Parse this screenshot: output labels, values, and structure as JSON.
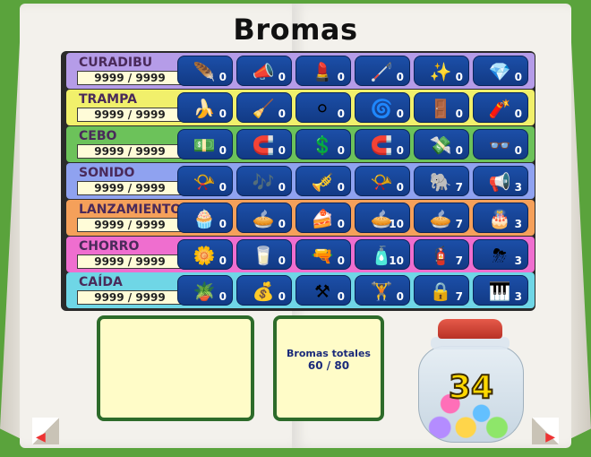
{
  "title": "Bromas",
  "rows": [
    {
      "label": "CURADIBU",
      "score": "9999 / 9999",
      "color": "#b59ce8",
      "items": [
        {
          "icon": "feather-icon",
          "glyph": "🪶",
          "count": "0"
        },
        {
          "icon": "megaphone-icon",
          "glyph": "📣",
          "count": "0"
        },
        {
          "icon": "lipstick-icon",
          "glyph": "💄",
          "count": "0"
        },
        {
          "icon": "cane-icon",
          "glyph": "🦯",
          "count": "0"
        },
        {
          "icon": "sparkles-icon",
          "glyph": "✨",
          "count": "0"
        },
        {
          "icon": "gems-icon",
          "glyph": "💎",
          "count": "0"
        }
      ]
    },
    {
      "label": "TRAMPA",
      "score": "9999 / 9999",
      "color": "#f1f06b",
      "items": [
        {
          "icon": "banana-icon",
          "glyph": "🍌",
          "count": "0"
        },
        {
          "icon": "rake-icon",
          "glyph": "🧹",
          "count": "0"
        },
        {
          "icon": "marbles-icon",
          "glyph": "⚪",
          "count": "0"
        },
        {
          "icon": "rug-icon",
          "glyph": "🌀",
          "count": "0"
        },
        {
          "icon": "trapdoor-icon",
          "glyph": "🚪",
          "count": "0"
        },
        {
          "icon": "dynamite-icon",
          "glyph": "🧨",
          "count": "0"
        }
      ]
    },
    {
      "label": "CEBO",
      "score": "9999 / 9999",
      "color": "#6cc25a",
      "items": [
        {
          "icon": "money-icon",
          "glyph": "💵",
          "count": "0"
        },
        {
          "icon": "magnet-icon",
          "glyph": "🧲",
          "count": "0"
        },
        {
          "icon": "dollar-bill-icon",
          "glyph": "💲",
          "count": "0"
        },
        {
          "icon": "big-magnet-icon",
          "glyph": "🧲",
          "count": "0"
        },
        {
          "icon": "cash-hook-icon",
          "glyph": "💸",
          "count": "0"
        },
        {
          "icon": "glasses-hook-icon",
          "glyph": "👓",
          "count": "0"
        }
      ]
    },
    {
      "label": "SONIDO",
      "score": "9999 / 9999",
      "color": "#8fa2f0",
      "items": [
        {
          "icon": "horn-icon",
          "glyph": "📯",
          "count": "0"
        },
        {
          "icon": "whistle-icon",
          "glyph": "🎶",
          "count": "0"
        },
        {
          "icon": "bugle-icon",
          "glyph": "🎺",
          "count": "0"
        },
        {
          "icon": "aoogah-icon",
          "glyph": "📯",
          "count": "0"
        },
        {
          "icon": "elephant-trunk-icon",
          "glyph": "🐘",
          "count": "7"
        },
        {
          "icon": "foghorn-icon",
          "glyph": "📢",
          "count": "3"
        }
      ]
    },
    {
      "label": "LANZAMIENTO",
      "score": "9999 / 9999",
      "color": "#f5a05a",
      "items": [
        {
          "icon": "cupcake-icon",
          "glyph": "🧁",
          "count": "0"
        },
        {
          "icon": "pie-slice-icon",
          "glyph": "🥧",
          "count": "0"
        },
        {
          "icon": "cream-pie-icon",
          "glyph": "🍰",
          "count": "0"
        },
        {
          "icon": "fruit-pie-icon",
          "glyph": "🥧",
          "count": "10"
        },
        {
          "icon": "whole-pie-icon",
          "glyph": "🥧",
          "count": "7"
        },
        {
          "icon": "birthday-cake-icon",
          "glyph": "🎂",
          "count": "3"
        }
      ]
    },
    {
      "label": "CHORRO",
      "score": "9999 / 9999",
      "color": "#ef6ecf",
      "items": [
        {
          "icon": "squirting-flower-icon",
          "glyph": "🌼",
          "count": "0"
        },
        {
          "icon": "water-glass-icon",
          "glyph": "🥛",
          "count": "0"
        },
        {
          "icon": "squirt-gun-icon",
          "glyph": "🔫",
          "count": "0"
        },
        {
          "icon": "seltzer-bottle-icon",
          "glyph": "🧴",
          "count": "10"
        },
        {
          "icon": "fire-hose-icon",
          "glyph": "🧯",
          "count": "7"
        },
        {
          "icon": "storm-cloud-icon",
          "glyph": "⛈",
          "count": "3"
        }
      ]
    },
    {
      "label": "CAÍDA",
      "score": "9999 / 9999",
      "color": "#6fd6e6",
      "items": [
        {
          "icon": "flower-pot-icon",
          "glyph": "🪴",
          "count": "0"
        },
        {
          "icon": "sandbag-icon",
          "glyph": "💰",
          "count": "0"
        },
        {
          "icon": "anvil-icon",
          "glyph": "⚒",
          "count": "0"
        },
        {
          "icon": "weight-icon",
          "glyph": "🏋",
          "count": "0"
        },
        {
          "icon": "safe-icon",
          "glyph": "🔒",
          "count": "7"
        },
        {
          "icon": "piano-icon",
          "glyph": "🎹",
          "count": "3"
        }
      ]
    }
  ],
  "totals": {
    "label": "Bromas totales",
    "value": "60 / 80"
  },
  "jar": {
    "count": "34"
  }
}
